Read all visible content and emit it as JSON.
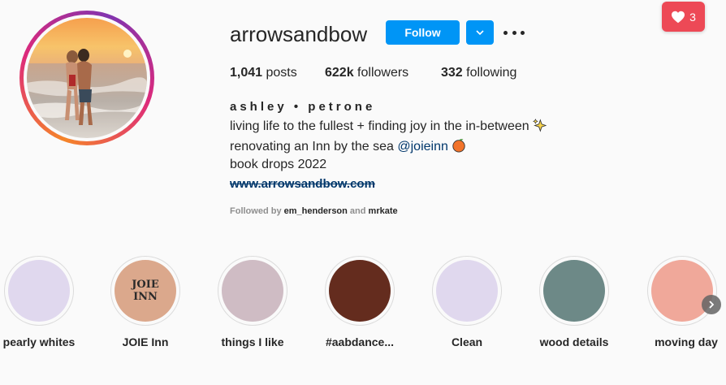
{
  "profile": {
    "username": "arrowsandbow",
    "follow_label": "Follow",
    "stats": {
      "posts_count": "1,041",
      "posts_label": "posts",
      "followers_count": "622k",
      "followers_label": "followers",
      "following_count": "332",
      "following_label": "following"
    },
    "full_name": "ashley • petrone",
    "bio_lines": {
      "line1": "living life to the fullest + finding joy in the in-between",
      "line2_prefix": "renovating an Inn by the sea ",
      "line2_mention": "@joieinn",
      "line3": "book drops 2022"
    },
    "website": "www.arrowsandbow.com",
    "followed_by": {
      "prefix": "Followed by ",
      "user1": "em_henderson",
      "connector": " and ",
      "user2": "mrkate"
    }
  },
  "notification": {
    "count": "3",
    "icon": "heart-icon",
    "color": "#ed4956"
  },
  "highlights": [
    {
      "label": "pearly whites",
      "color": "#e0d8ee"
    },
    {
      "label": "JOIE Inn",
      "color": "#dba88c",
      "logo_text_top": "JOIE",
      "logo_text_bottom": "INN"
    },
    {
      "label": "things I like",
      "color": "#cfbcc4"
    },
    {
      "label": "#aabdance...",
      "color": "#642c1e"
    },
    {
      "label": "Clean",
      "color": "#e0d8ee"
    },
    {
      "label": "wood details",
      "color": "#6d8987"
    },
    {
      "label": "moving day",
      "color": "#f0a89a"
    }
  ],
  "colors": {
    "accent": "#0095f6",
    "link": "#00376b"
  }
}
